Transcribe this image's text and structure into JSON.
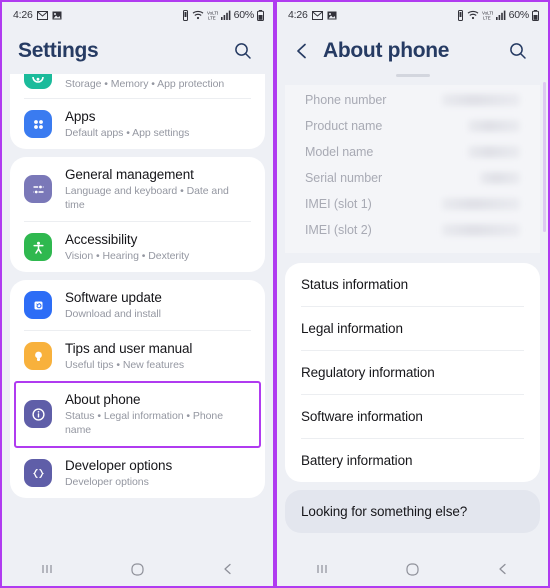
{
  "status_bar": {
    "time": "4:26",
    "left_icons": [
      "gmail-icon",
      "photos-icon"
    ],
    "right_icons": [
      "vibrate-icon",
      "wifi-icon",
      "lte-icon",
      "signal-icon"
    ],
    "battery_percent": "60%"
  },
  "left_screen": {
    "appbar": {
      "title": "Settings",
      "search_icon": "search-icon"
    },
    "groups": [
      {
        "id": "device-care-group",
        "cut_top": true,
        "items": [
          {
            "id": "device-care",
            "title": "",
            "subtitle": "Storage • Memory • App protection",
            "icon": "device-care-icon",
            "icon_color": "#1bbb9b"
          },
          {
            "id": "apps",
            "title": "Apps",
            "subtitle": "Default apps • App settings",
            "icon": "apps-grid-icon",
            "icon_color": "#3a7bf0"
          }
        ]
      },
      {
        "id": "general-group",
        "items": [
          {
            "id": "general-management",
            "title": "General management",
            "subtitle": "Language and keyboard • Date and time",
            "icon": "sliders-icon",
            "icon_color": "#7a78b8"
          },
          {
            "id": "accessibility",
            "title": "Accessibility",
            "subtitle": "Vision • Hearing • Dexterity",
            "icon": "accessibility-person-icon",
            "icon_color": "#2fb84f"
          }
        ]
      },
      {
        "id": "about-group",
        "items": [
          {
            "id": "software-update",
            "title": "Software update",
            "subtitle": "Download and install",
            "icon": "software-update-icon",
            "icon_color": "#2d6df6"
          },
          {
            "id": "tips-and-user-manual",
            "title": "Tips and user manual",
            "subtitle": "Useful tips • New features",
            "icon": "lightbulb-icon",
            "icon_color": "#f8b13c"
          },
          {
            "id": "about-phone",
            "title": "About phone",
            "subtitle": "Status • Legal information • Phone name",
            "icon": "info-circle-icon",
            "icon_color": "#5f5ea8",
            "highlighted": true
          },
          {
            "id": "developer-options",
            "title": "Developer options",
            "subtitle": "Developer options",
            "icon": "code-braces-icon",
            "icon_color": "#5f5ea8"
          }
        ]
      }
    ]
  },
  "right_screen": {
    "appbar": {
      "back_icon": "chevron-left-icon",
      "title": "About phone",
      "search_icon": "search-icon"
    },
    "info_rows": [
      {
        "label": "Phone number",
        "value_redacted": true,
        "value_width": "wide"
      },
      {
        "label": "Product name",
        "value_redacted": true,
        "value_width": "short"
      },
      {
        "label": "Model name",
        "value_redacted": true,
        "value_width": "short"
      },
      {
        "label": "Serial number",
        "value_redacted": true,
        "value_width": "tiny"
      },
      {
        "label": "IMEI (slot 1)",
        "value_redacted": true,
        "value_width": "wide"
      },
      {
        "label": "IMEI (slot 2)",
        "value_redacted": true,
        "value_width": "wide"
      }
    ],
    "menu_items": [
      "Status information",
      "Legal information",
      "Regulatory information",
      "Software information",
      "Battery information"
    ],
    "footer_item": "Looking for something else?"
  },
  "nav_bar": {
    "recents_label": "recents-button",
    "home_label": "home-button",
    "back_label": "back-button"
  },
  "colors": {
    "highlight": "#b03bf0",
    "appbar_title": "#263b63",
    "background": "#eef0f5",
    "card": "#ffffff",
    "subtitle": "#9497a1"
  }
}
